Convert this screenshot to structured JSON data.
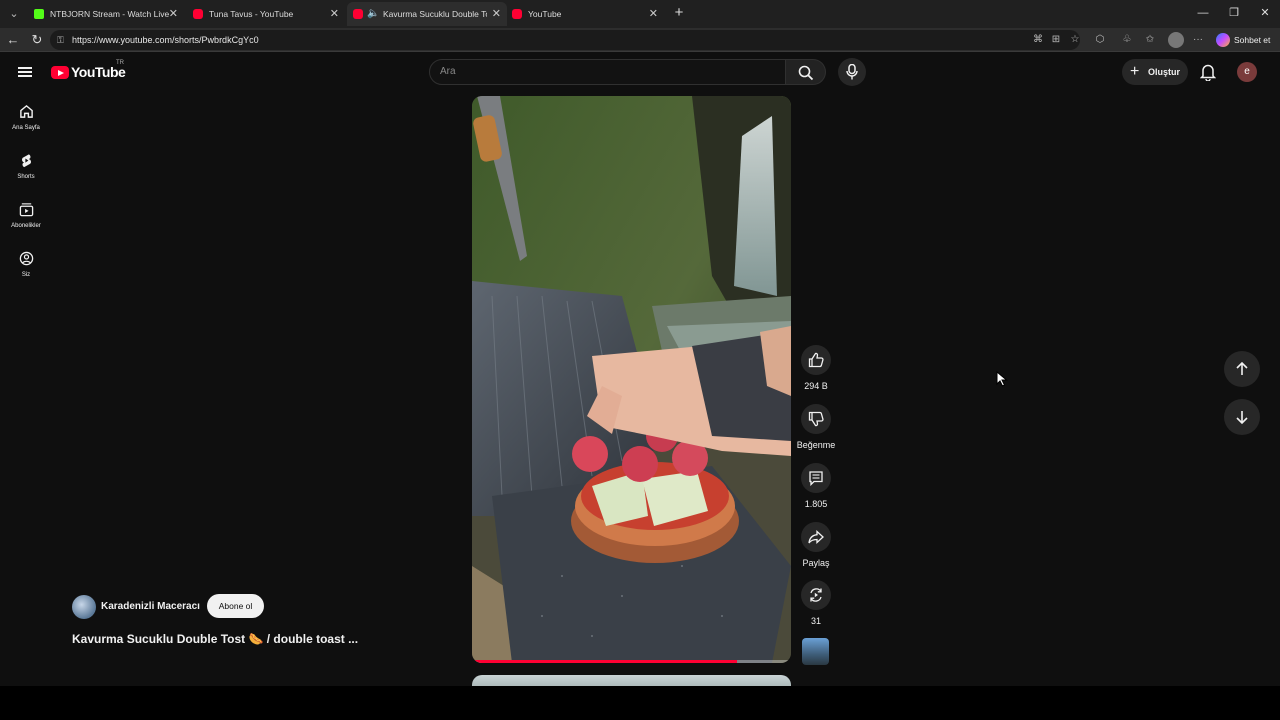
{
  "browser": {
    "tabs": [
      {
        "title": "NTBJORN Stream - Watch Live on",
        "favicon": "kick-icon",
        "active": false
      },
      {
        "title": "Tuna Tavus - YouTube",
        "favicon": "youtube-icon",
        "active": false
      },
      {
        "title": "Kavurma Sucuklu Double Tost",
        "favicon": "youtube-icon",
        "active": true,
        "audio": true
      },
      {
        "title": "YouTube",
        "favicon": "youtube-icon",
        "active": false
      }
    ],
    "url": "https://www.youtube.com/shorts/PwbrdkCgYc0",
    "copilot_label": "Sohbet et"
  },
  "masthead": {
    "logo_text": "YouTube",
    "region": "TR",
    "search_placeholder": "Ara",
    "create_label": "Oluştur",
    "avatar_letter": "e"
  },
  "guide": {
    "items": [
      {
        "label": "Ana Sayfa",
        "icon": "home-icon"
      },
      {
        "label": "Shorts",
        "icon": "shorts-icon"
      },
      {
        "label": "Abonelikler",
        "icon": "subscriptions-icon"
      },
      {
        "label": "Siz",
        "icon": "you-icon"
      }
    ]
  },
  "short": {
    "channel": "Karadenizli Maceracı",
    "subscribe_label": "Abone ol",
    "title": "Kavurma Sucuklu Double Tost 🌭 / double toast ...",
    "progress": 0.83,
    "actions": {
      "like": "294 B",
      "dislike": "Beğenme",
      "comments": "1.805",
      "share": "Paylaş",
      "remix": "31"
    }
  },
  "colors": {
    "accent": "#ff0033",
    "background": "#0f0f0f",
    "chip": "#272727"
  }
}
